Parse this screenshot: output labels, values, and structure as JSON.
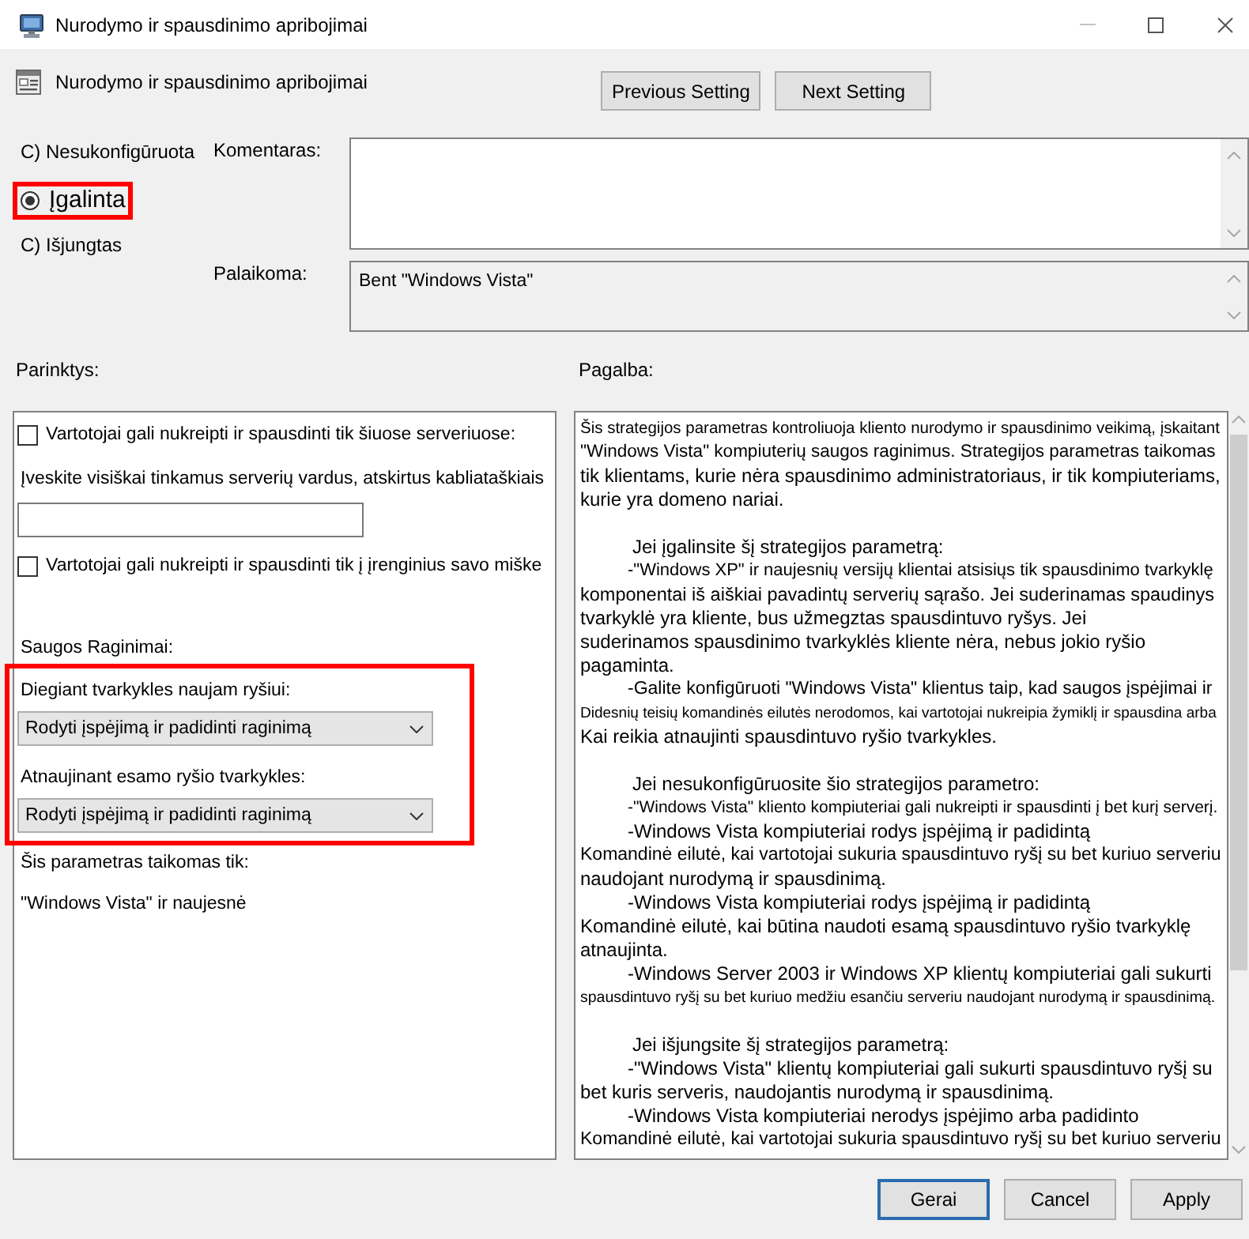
{
  "window": {
    "title": "Nurodymo ir spausdinimo apribojimai"
  },
  "header": {
    "title": "Nurodymo ir spausdinimo apribojimai",
    "buttons": [
      "Previous Setting",
      "Next Setting"
    ]
  },
  "state_options": [
    {
      "label": "C) Nesukonfigūruota",
      "selected": false,
      "highlighted": false
    },
    {
      "label": "Įgalinta",
      "selected": true,
      "highlighted": true
    },
    {
      "label": "C) Išjungtas",
      "selected": false,
      "highlighted": false
    }
  ],
  "comment": {
    "label": "Komentaras:"
  },
  "supported": {
    "label": "Palaikoma:",
    "value": "Bent \"Windows Vista\""
  },
  "options": {
    "label": "Parinktys:",
    "items": [
      {
        "kind": "checkbox",
        "label": "Vartotojai gali nukreipti ir spausdinti tik šiuose serveriuose:",
        "checked": false
      },
      {
        "kind": "text",
        "text": "Įveskite visiškai tinkamus serverių vardus, atskirtus kabliataškiais"
      },
      {
        "kind": "input"
      },
      {
        "kind": "checkbox",
        "label": "Vartotojai gali nukreipti ir spausdinti tik į įrenginius savo miške",
        "checked": false
      },
      {
        "kind": "heading",
        "text": "Saugos Raginimai:"
      },
      {
        "kind": "group",
        "highlighted": true,
        "items": [
          {
            "label": "Diegiant tvarkykles naujam ryšiui:",
            "value": "Rodyti įspėjimą ir padidinti raginimą"
          },
          {
            "label": "Atnaujinant esamo ryšio tvarkykles:",
            "value": "Rodyti įspėjimą ir padidinti raginimą"
          }
        ]
      },
      {
        "kind": "text",
        "text": "Šis parametras taikomas tik:"
      },
      {
        "kind": "text",
        "text": "\"Windows Vista\" ir naujesnė"
      }
    ]
  },
  "help": {
    "label": "Pagalba:",
    "blocks": [
      {
        "kind": "intro",
        "lines": [
          "Šis strategijos parametras kontroliuoja kliento nurodymo ir spausdinimo veikimą, įskaitant",
          "\"Windows Vista\" kompiuterių saugos raginimus. Strategijos parametras taikomas",
          "tik klientams, kurie nėra spausdinimo administratoriaus, ir tik kompiuteriams,",
          "kurie yra domeno nariai."
        ]
      },
      {
        "kind": "heading",
        "lines": [
          "Jei įgalinsite šį strategijos parametrą:"
        ]
      },
      {
        "kind": "bullet",
        "lines": [
          "-\"Windows XP\" ir naujesnių versijų klientai atsisiųs tik spausdinimo tvarkyklę",
          "komponentai iš aiškiai pavadintų serverių sąrašo. Jei suderinamas spaudinys",
          "tvarkyklė yra kliente, bus užmegztas spausdintuvo ryšys. Jei",
          "suderinamos spausdinimo tvarkyklės kliente nėra, nebus jokio ryšio",
          "pagaminta."
        ]
      },
      {
        "kind": "bullet",
        "lines": [
          "-Galite konfigūruoti \"Windows Vista\" klientus taip, kad saugos įspėjimai ir",
          "Didesnių teisių komandinės eilutės nerodomos, kai vartotojai nukreipia žymiklį ir spausdina arba",
          "Kai reikia atnaujinti spausdintuvo ryšio tvarkykles."
        ]
      },
      {
        "kind": "heading",
        "lines": [
          "Jei nesukonfigūruosite šio strategijos parametro:"
        ]
      },
      {
        "kind": "bullet",
        "lines": [
          "-\"Windows Vista\" kliento kompiuteriai gali nukreipti ir spausdinti į bet kurį serverį."
        ]
      },
      {
        "kind": "bullet",
        "lines": [
          "-Windows Vista kompiuteriai rodys įspėjimą ir padidintą",
          "Komandinė eilutė, kai vartotojai sukuria spausdintuvo ryšį su bet kuriuo serveriu",
          "naudojant nurodymą ir spausdinimą."
        ]
      },
      {
        "kind": "bullet",
        "lines": [
          "-Windows Vista kompiuteriai rodys įspėjimą ir padidintą",
          "Komandinė eilutė, kai būtina naudoti esamą spausdintuvo ryšio tvarkyklę",
          "atnaujinta."
        ]
      },
      {
        "kind": "bullet",
        "lines": [
          "-Windows Server 2003 ir Windows XP klientų kompiuteriai gali sukurti",
          "spausdintuvo ryšį su bet kuriuo medžiu esančiu serveriu naudojant nurodymą ir spausdinimą."
        ]
      },
      {
        "kind": "heading",
        "lines": [
          "Jei išjungsite šį strategijos parametrą:"
        ]
      },
      {
        "kind": "bullet",
        "lines": [
          "-\"Windows Vista\" klientų kompiuteriai gali sukurti spausdintuvo ryšį su",
          "bet kuris serveris, naudojantis nurodymą ir spausdinimą."
        ]
      },
      {
        "kind": "bullet",
        "lines": [
          "-Windows Vista kompiuteriai nerodys įspėjimo arba padidinto",
          "Komandinė eilutė, kai vartotojai sukuria spausdintuvo ryšį su bet kuriuo serveriu"
        ]
      }
    ]
  },
  "footer": {
    "buttons": [
      {
        "label": "Gerai",
        "default": true
      },
      {
        "label": "Cancel",
        "default": false
      },
      {
        "label": "Apply",
        "default": false
      }
    ]
  }
}
